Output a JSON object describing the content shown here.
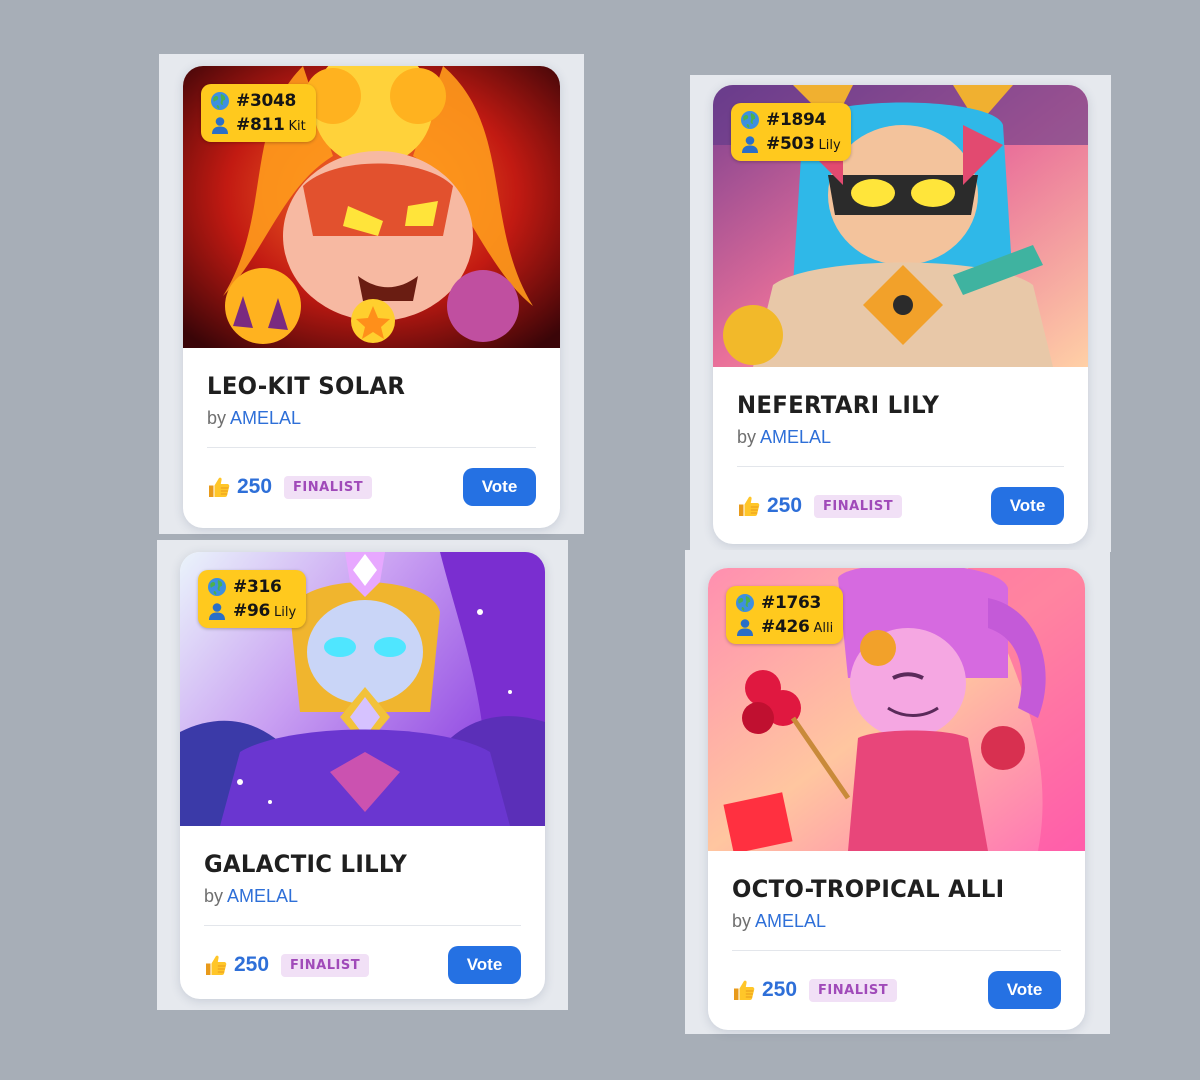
{
  "cards": [
    {
      "global_rank": "#3048",
      "brawler_rank": "#811",
      "brawler": "Kit",
      "title": "LEO-KIT SOLAR",
      "by_label": "by",
      "author": "AMELAL",
      "likes": "250",
      "status": "FINALIST",
      "vote_label": "Vote"
    },
    {
      "global_rank": "#1894",
      "brawler_rank": "#503",
      "brawler": "Lily",
      "title": "NEFERTARI LILY",
      "by_label": "by",
      "author": "AMELAL",
      "likes": "250",
      "status": "FINALIST",
      "vote_label": "Vote"
    },
    {
      "global_rank": "#316",
      "brawler_rank": "#96",
      "brawler": "Lily",
      "title": "GALACTIC LILLY",
      "by_label": "by",
      "author": "AMELAL",
      "likes": "250",
      "status": "FINALIST",
      "vote_label": "Vote"
    },
    {
      "global_rank": "#1763",
      "brawler_rank": "#426",
      "brawler": "Alli",
      "title": "OCTO-TROPICAL ALLI",
      "by_label": "by",
      "author": "AMELAL",
      "likes": "250",
      "status": "FINALIST",
      "vote_label": "Vote"
    }
  ],
  "icons": {
    "global_rank": "globe-icon",
    "brawler_rank": "person-icon",
    "likes": "thumbs-up-icon"
  },
  "colors": {
    "background": "#a7aeb7",
    "rank_badge": "#ffc91e",
    "accent_blue": "#2571e3",
    "finalist_bg": "#f1e0f6",
    "finalist_text": "#a04ab9"
  }
}
